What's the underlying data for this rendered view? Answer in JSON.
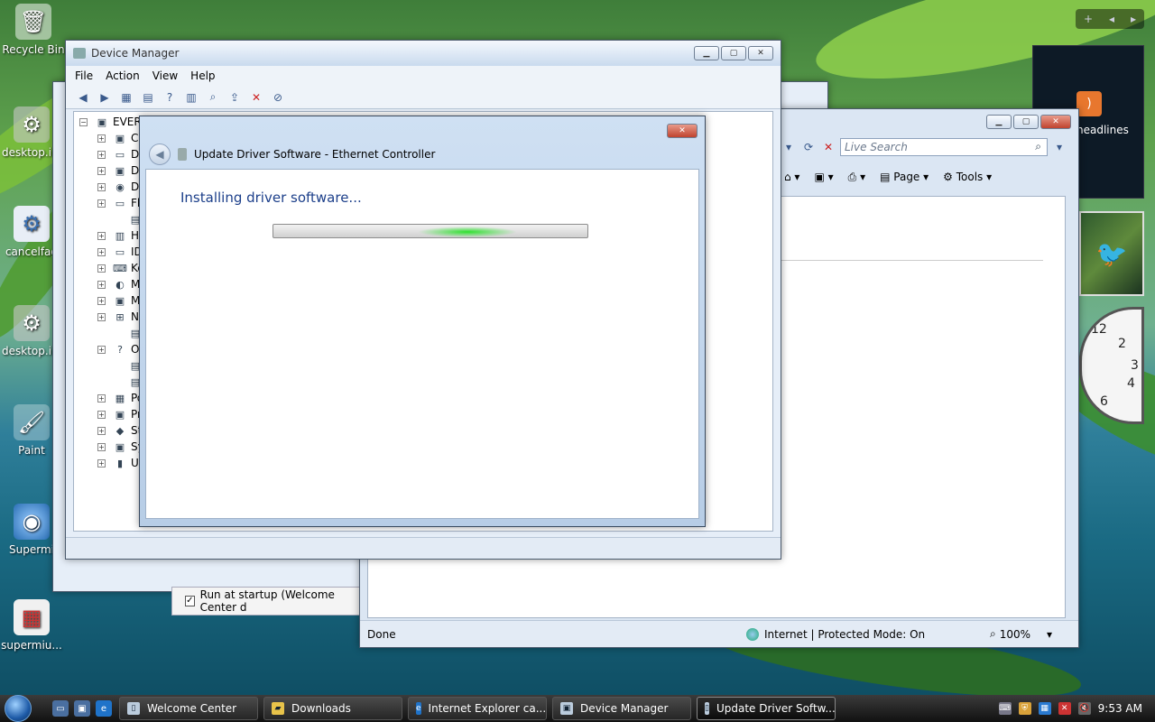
{
  "desktop": {
    "icons": [
      {
        "label": "Recycle Bin",
        "glyph": "🗑"
      },
      {
        "label": "desktop.ini",
        "glyph": "⚙"
      },
      {
        "label": "cancelfag",
        "glyph": "⚙"
      },
      {
        "label": "desktop.ini",
        "glyph": "⚙"
      },
      {
        "label": "Paint",
        "glyph": "🖌"
      },
      {
        "label": "Supermi",
        "glyph": "◉"
      },
      {
        "label": "supermiu...",
        "glyph": "▦"
      }
    ]
  },
  "device_manager": {
    "title": "Device Manager",
    "menu": [
      "File",
      "Action",
      "View",
      "Help"
    ],
    "tree_root": "EVERY",
    "tree_items": [
      "Co",
      "Di",
      "Di",
      "DV",
      "Fl",
      "",
      "H",
      "ID",
      "Ke",
      "M",
      "M",
      "Ne",
      "",
      "Ot",
      "",
      "",
      "Po",
      "Pr",
      "St",
      "Sy",
      "Ur"
    ]
  },
  "ie": {
    "search_placeholder": "Live Search",
    "cmd_page": "Page",
    "cmd_tools": "Tools",
    "status_done": "Done",
    "status_zone": "Internet | Protected Mode: On",
    "zoom": "100%"
  },
  "welcome": {
    "run_at_startup": "Run at startup (Welcome Center d"
  },
  "dialog": {
    "title": "Update Driver Software - Ethernet Controller",
    "heading": "Installing driver software..."
  },
  "sidebar": {
    "feed_label": "headlines",
    "plus": "+",
    "clock_numbers": [
      "12",
      "2",
      "3",
      "4",
      "6"
    ]
  },
  "taskbar": {
    "tasks": [
      {
        "label": "Welcome Center",
        "active": false
      },
      {
        "label": "Downloads",
        "active": false
      },
      {
        "label": "Internet Explorer ca...",
        "active": false
      },
      {
        "label": "Device Manager",
        "active": false
      },
      {
        "label": "Update Driver Softw...",
        "active": true
      }
    ],
    "clock": "9:53 AM"
  }
}
